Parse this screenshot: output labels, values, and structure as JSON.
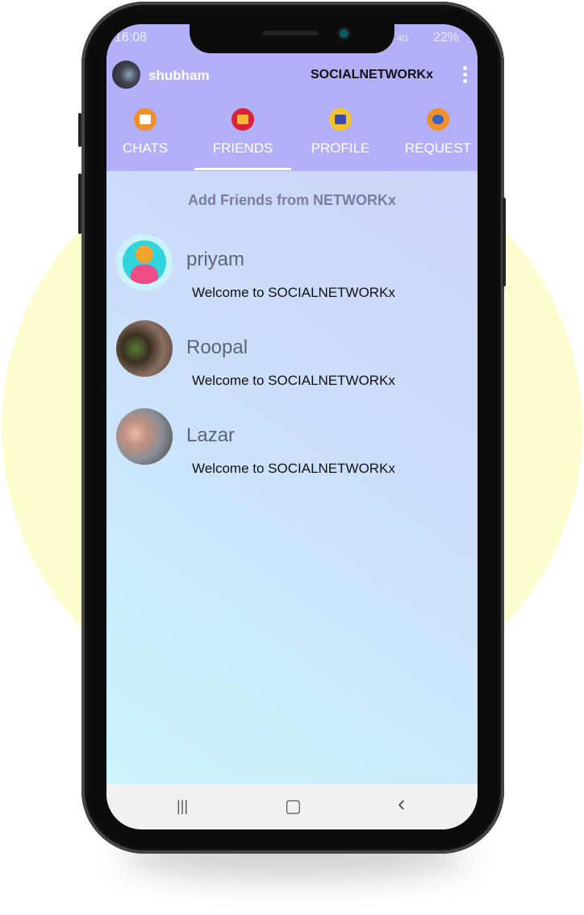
{
  "status": {
    "time": "16:08",
    "network": "4G",
    "battery": "22%"
  },
  "appbar": {
    "username": "shubham",
    "title": "SOCIALNETWORKx"
  },
  "tabs": [
    {
      "label": "CHATS",
      "icon": "chat-icon",
      "color": "#f0902a"
    },
    {
      "label": "FRIENDS",
      "icon": "contacts-book-icon",
      "color": "#d8213a",
      "active": true
    },
    {
      "label": "PROFILE",
      "icon": "profile-card-icon",
      "color": "#f5c22a"
    },
    {
      "label": "REQUEST",
      "icon": "friend-request-icon",
      "color": "#f0902a"
    }
  ],
  "header": "Add Friends from NETWORKx",
  "friends": [
    {
      "name": "priyam",
      "message": "Welcome to SOCIALNETWORKx"
    },
    {
      "name": "Roopal",
      "message": "Welcome to SOCIALNETWORKx"
    },
    {
      "name": "Lazar",
      "message": "Welcome to SOCIALNETWORKx"
    }
  ],
  "navbar": {
    "recent": "|||",
    "home": "▢",
    "back": "‹"
  }
}
